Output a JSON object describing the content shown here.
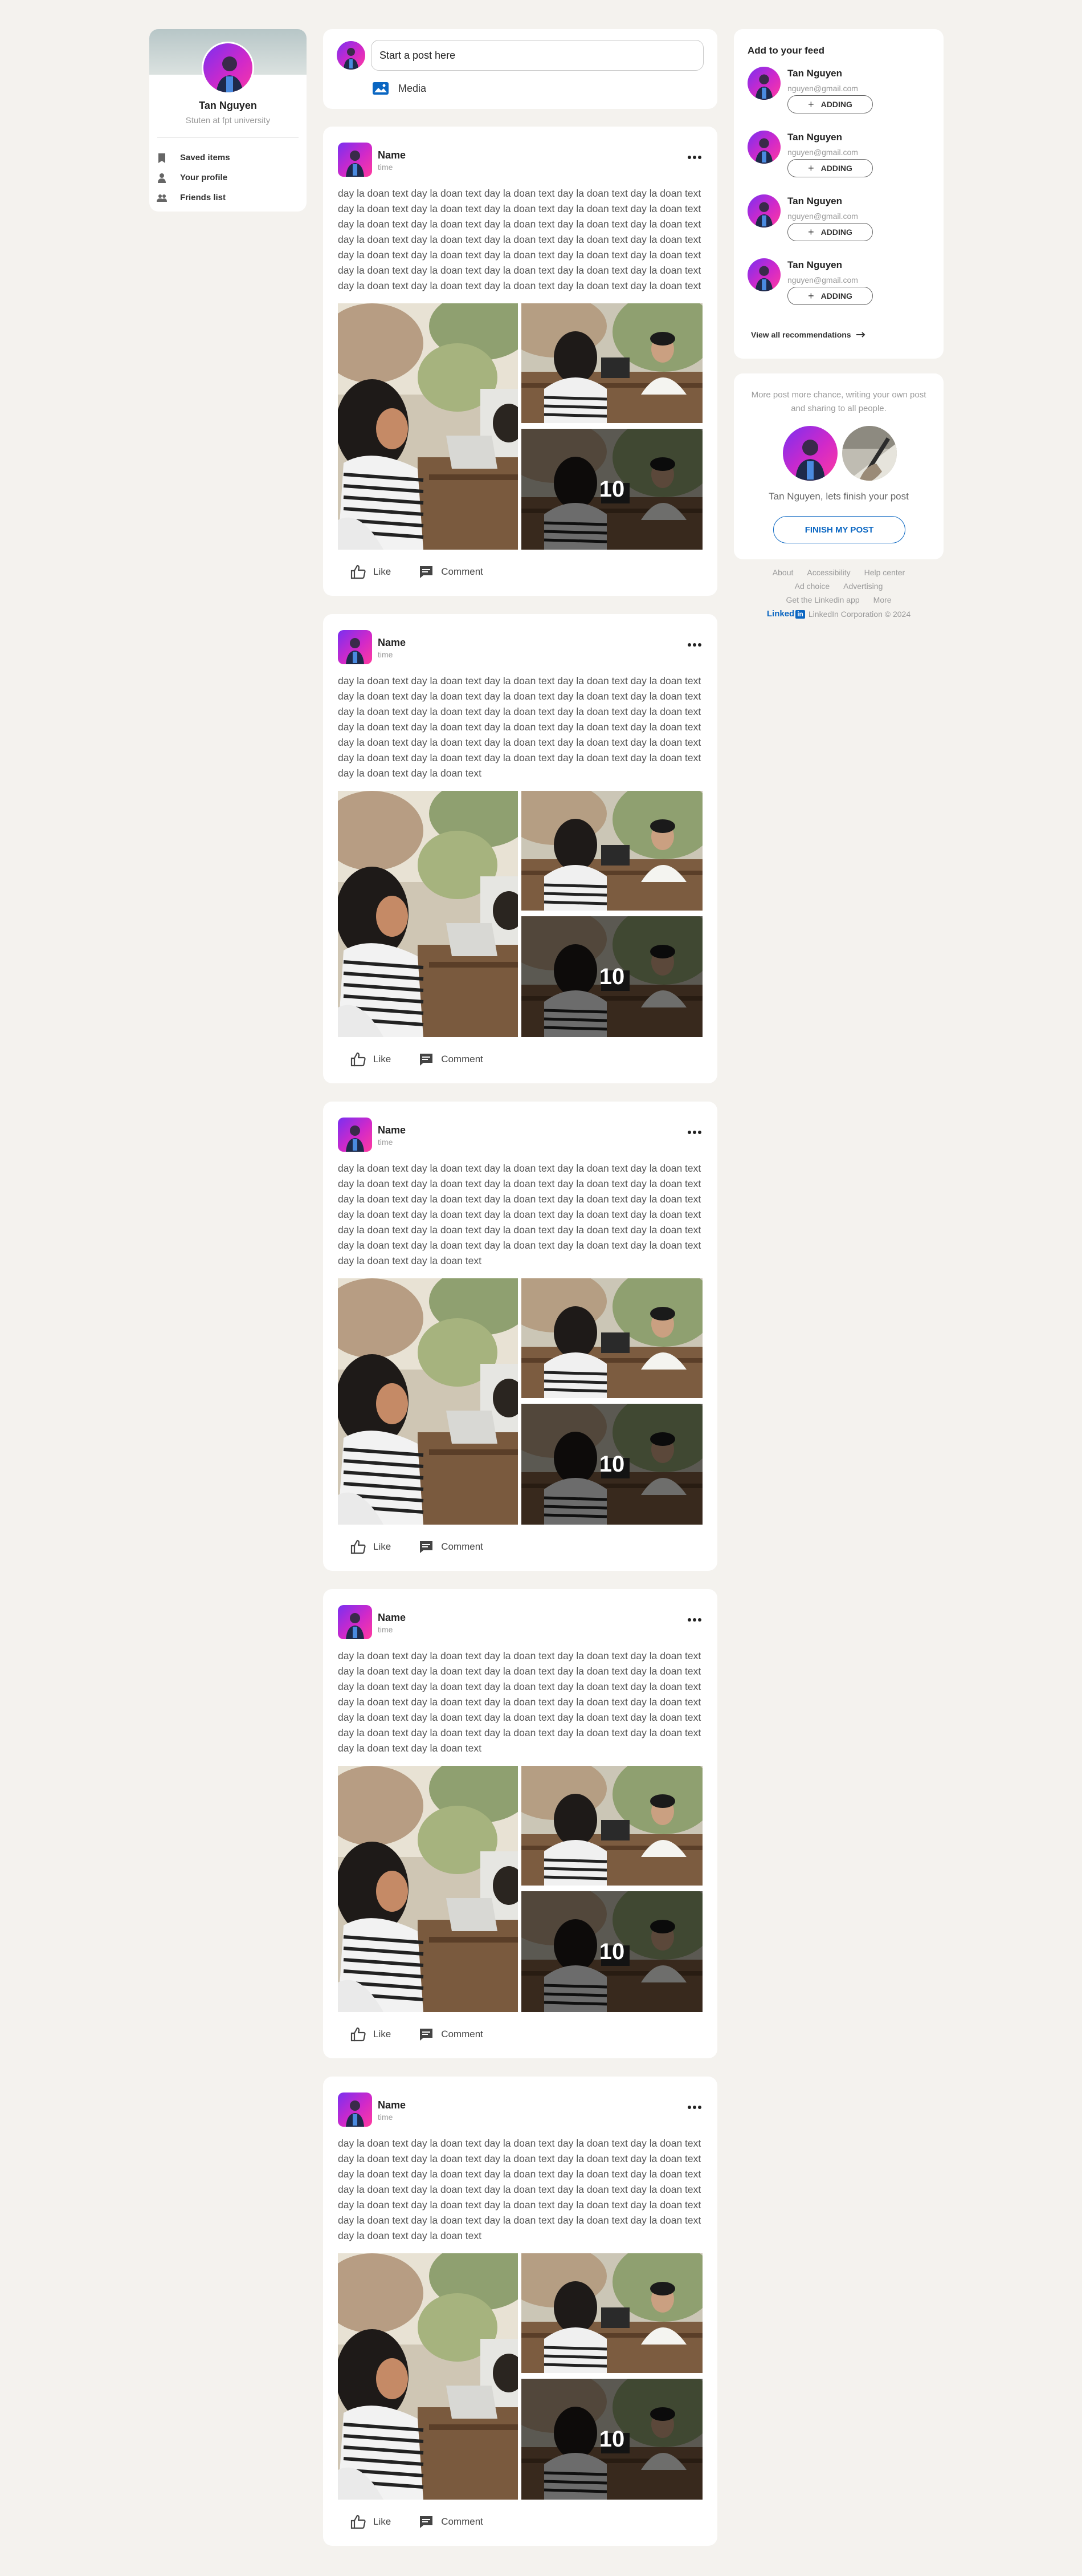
{
  "profile": {
    "name": "Tan Nguyen",
    "subtitle": "Stuten at fpt university",
    "menu": [
      {
        "label": "Saved items",
        "icon": "bookmark-icon"
      },
      {
        "label": "Your profile",
        "icon": "person-icon"
      },
      {
        "label": "Friends list",
        "icon": "people-icon"
      }
    ]
  },
  "composer": {
    "placeholder": "Start a post here",
    "media_label": "Media"
  },
  "posts": [
    {
      "name": "Name",
      "time": "time",
      "text": "day la doan text day la doan text day la doan text day la doan text day la doan text day la doan text day la doan text day la doan text day la doan text day la doan text day la doan text day la doan text day la doan text day la doan text day la doan text day la doan text day la doan text day la doan text day la doan text day la doan text day la doan text day la doan text day la doan text day la doan text day la doan text day la doan text day la doan text day la doan text day la doan text day la doan text day la doan text day la doan text day la doan text day la doan text day la doan text",
      "more_count": "10",
      "like_label": "Like",
      "comment_label": "Comment"
    },
    {
      "name": "Name",
      "time": "time",
      "text": "day la doan text day la doan text day la doan text day la doan text day la doan text day la doan text day la doan text day la doan text day la doan text day la doan text day la doan text day la doan text day la doan text day la doan text day la doan text day la doan text day la doan text day la doan text day la doan text day la doan text day la doan text day la doan text day la doan text day la doan text day la doan text day la doan text day la doan text day la doan text day la doan text day la doan text day la doan text day la doan text",
      "more_count": "10",
      "like_label": "Like",
      "comment_label": "Comment"
    },
    {
      "name": "Name",
      "time": "time",
      "text": "day la doan text day la doan text day la doan text day la doan text day la doan text day la doan text day la doan text day la doan text day la doan text day la doan text day la doan text day la doan text day la doan text day la doan text day la doan text day la doan text day la doan text day la doan text day la doan text day la doan text day la doan text day la doan text day la doan text day la doan text day la doan text day la doan text day la doan text day la doan text day la doan text day la doan text day la doan text day la doan text",
      "more_count": "10",
      "like_label": "Like",
      "comment_label": "Comment"
    },
    {
      "name": "Name",
      "time": "time",
      "text": "day la doan text day la doan text day la doan text day la doan text day la doan text day la doan text day la doan text day la doan text day la doan text day la doan text day la doan text day la doan text day la doan text day la doan text day la doan text day la doan text day la doan text day la doan text day la doan text day la doan text day la doan text day la doan text day la doan text day la doan text day la doan text day la doan text day la doan text day la doan text day la doan text day la doan text day la doan text day la doan text",
      "more_count": "10",
      "like_label": "Like",
      "comment_label": "Comment"
    },
    {
      "name": "Name",
      "time": "time",
      "text": "day la doan text day la doan text day la doan text day la doan text day la doan text day la doan text day la doan text day la doan text day la doan text day la doan text day la doan text day la doan text day la doan text day la doan text day la doan text day la doan text day la doan text day la doan text day la doan text day la doan text day la doan text day la doan text day la doan text day la doan text day la doan text day la doan text day la doan text day la doan text day la doan text day la doan text day la doan text day la doan text",
      "more_count": "10",
      "like_label": "Like",
      "comment_label": "Comment"
    }
  ],
  "feed": {
    "title": "Add to your feed",
    "recommendations": [
      {
        "name": "Tan Nguyen",
        "email": "nguyen@gmail.com",
        "button": "ADDING"
      },
      {
        "name": "Tan Nguyen",
        "email": "nguyen@gmail.com",
        "button": "ADDING"
      },
      {
        "name": "Tan Nguyen",
        "email": "nguyen@gmail.com",
        "button": "ADDING"
      },
      {
        "name": "Tan Nguyen",
        "email": "nguyen@gmail.com",
        "button": "ADDING"
      }
    ],
    "view_all": "View all recommendations"
  },
  "finish": {
    "text": "More post more chance, writing your own post and sharing to all people.",
    "name_line": "Tan Nguyen, lets finish your post",
    "button": "FINISH MY POST"
  },
  "footer": {
    "row1": [
      "About",
      "Accessibility",
      "Help center"
    ],
    "row2": [
      "Ad choice",
      "Advertising"
    ],
    "row3": [
      "Get the Linkedin app",
      "More"
    ],
    "brand_word": "Linked",
    "brand_box": "in",
    "copyright": "LinkedIn Corporation © 2024"
  },
  "colors": {
    "accent": "#0a66c2",
    "background": "#f4f2ee"
  }
}
